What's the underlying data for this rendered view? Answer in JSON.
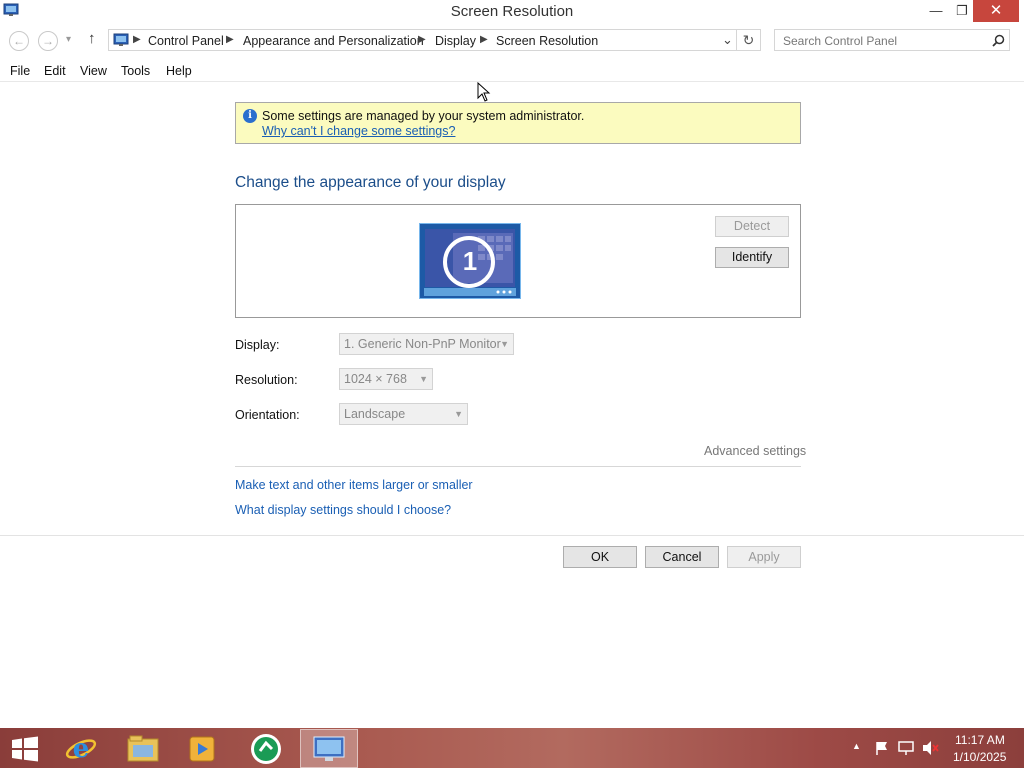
{
  "window": {
    "title": "Screen Resolution",
    "minimize_glyph": "—",
    "restore_glyph": "❐",
    "close_glyph": "✕"
  },
  "nav": {
    "back": "←",
    "forward": "→",
    "recent": "▾",
    "up": "↑",
    "address_dropdown": "⌄",
    "refresh": "↻"
  },
  "breadcrumbs": [
    "Control Panel",
    "Appearance and Personalization",
    "Display",
    "Screen Resolution"
  ],
  "search": {
    "placeholder": "Search Control Panel"
  },
  "menu": [
    "File",
    "Edit",
    "View",
    "Tools",
    "Help"
  ],
  "info": {
    "message": "Some settings are managed by your system administrator.",
    "link": "Why can't I change some settings?"
  },
  "heading": "Change the appearance of your display",
  "preview": {
    "monitor_number": "1",
    "detect_label": "Detect",
    "identify_label": "Identify"
  },
  "settings": {
    "display_label": "Display:",
    "display_value": "1. Generic Non-PnP Monitor",
    "resolution_label": "Resolution:",
    "resolution_value": "1024 × 768",
    "orientation_label": "Orientation:",
    "orientation_value": "Landscape"
  },
  "advanced_link": "Advanced settings",
  "links": [
    "Make text and other items larger or smaller",
    "What display settings should I choose?"
  ],
  "buttons": {
    "ok": "OK",
    "cancel": "Cancel",
    "apply": "Apply"
  },
  "taskbar": {
    "items": [
      "start-icon",
      "internet-explorer-icon",
      "file-explorer-icon",
      "media-player-icon",
      "app-icon",
      "screen-resolution-icon"
    ],
    "time": "11:17 AM",
    "date": "1/10/2025"
  },
  "colors": {
    "heading": "#1c4e8a",
    "link": "#1a5fb4",
    "infobar": "#fbfbbf",
    "close": "#c7463d"
  }
}
